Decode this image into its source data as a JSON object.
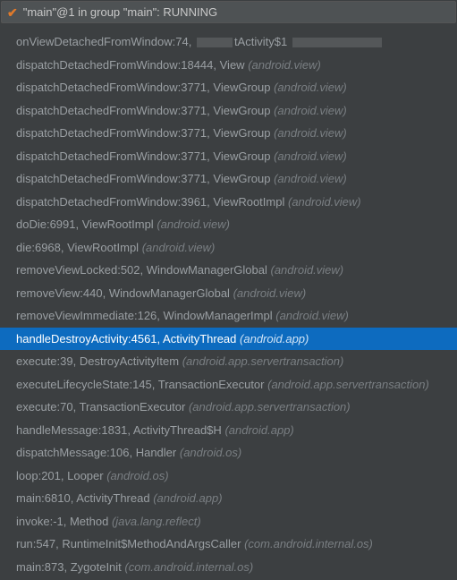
{
  "header": {
    "title": "\"main\"@1 in group \"main\": RUNNING"
  },
  "frames": [
    {
      "method": "onViewDetachedFromWindow:74,",
      "redacted": true,
      "tail": "tActivity$1",
      "pkg": "",
      "selected": false
    },
    {
      "method": "dispatchDetachedFromWindow:18444, View",
      "pkg": "(android.view)",
      "selected": false
    },
    {
      "method": "dispatchDetachedFromWindow:3771, ViewGroup",
      "pkg": "(android.view)",
      "selected": false
    },
    {
      "method": "dispatchDetachedFromWindow:3771, ViewGroup",
      "pkg": "(android.view)",
      "selected": false
    },
    {
      "method": "dispatchDetachedFromWindow:3771, ViewGroup",
      "pkg": "(android.view)",
      "selected": false
    },
    {
      "method": "dispatchDetachedFromWindow:3771, ViewGroup",
      "pkg": "(android.view)",
      "selected": false
    },
    {
      "method": "dispatchDetachedFromWindow:3771, ViewGroup",
      "pkg": "(android.view)",
      "selected": false
    },
    {
      "method": "dispatchDetachedFromWindow:3961, ViewRootImpl",
      "pkg": "(android.view)",
      "selected": false
    },
    {
      "method": "doDie:6991, ViewRootImpl",
      "pkg": "(android.view)",
      "selected": false
    },
    {
      "method": "die:6968, ViewRootImpl",
      "pkg": "(android.view)",
      "selected": false
    },
    {
      "method": "removeViewLocked:502, WindowManagerGlobal",
      "pkg": "(android.view)",
      "selected": false
    },
    {
      "method": "removeView:440, WindowManagerGlobal",
      "pkg": "(android.view)",
      "selected": false
    },
    {
      "method": "removeViewImmediate:126, WindowManagerImpl",
      "pkg": "(android.view)",
      "selected": false
    },
    {
      "method": "handleDestroyActivity:4561, ActivityThread",
      "pkg": "(android.app)",
      "selected": true
    },
    {
      "method": "execute:39, DestroyActivityItem",
      "pkg": "(android.app.servertransaction)",
      "selected": false
    },
    {
      "method": "executeLifecycleState:145, TransactionExecutor",
      "pkg": "(android.app.servertransaction)",
      "selected": false
    },
    {
      "method": "execute:70, TransactionExecutor",
      "pkg": "(android.app.servertransaction)",
      "selected": false
    },
    {
      "method": "handleMessage:1831, ActivityThread$H",
      "pkg": "(android.app)",
      "selected": false
    },
    {
      "method": "dispatchMessage:106, Handler",
      "pkg": "(android.os)",
      "selected": false
    },
    {
      "method": "loop:201, Looper",
      "pkg": "(android.os)",
      "selected": false
    },
    {
      "method": "main:6810, ActivityThread",
      "pkg": "(android.app)",
      "selected": false
    },
    {
      "method": "invoke:-1, Method",
      "pkg": "(java.lang.reflect)",
      "selected": false
    },
    {
      "method": "run:547, RuntimeInit$MethodAndArgsCaller",
      "pkg": "(com.android.internal.os)",
      "selected": false
    },
    {
      "method": "main:873, ZygoteInit",
      "pkg": "(com.android.internal.os)",
      "selected": false
    }
  ]
}
